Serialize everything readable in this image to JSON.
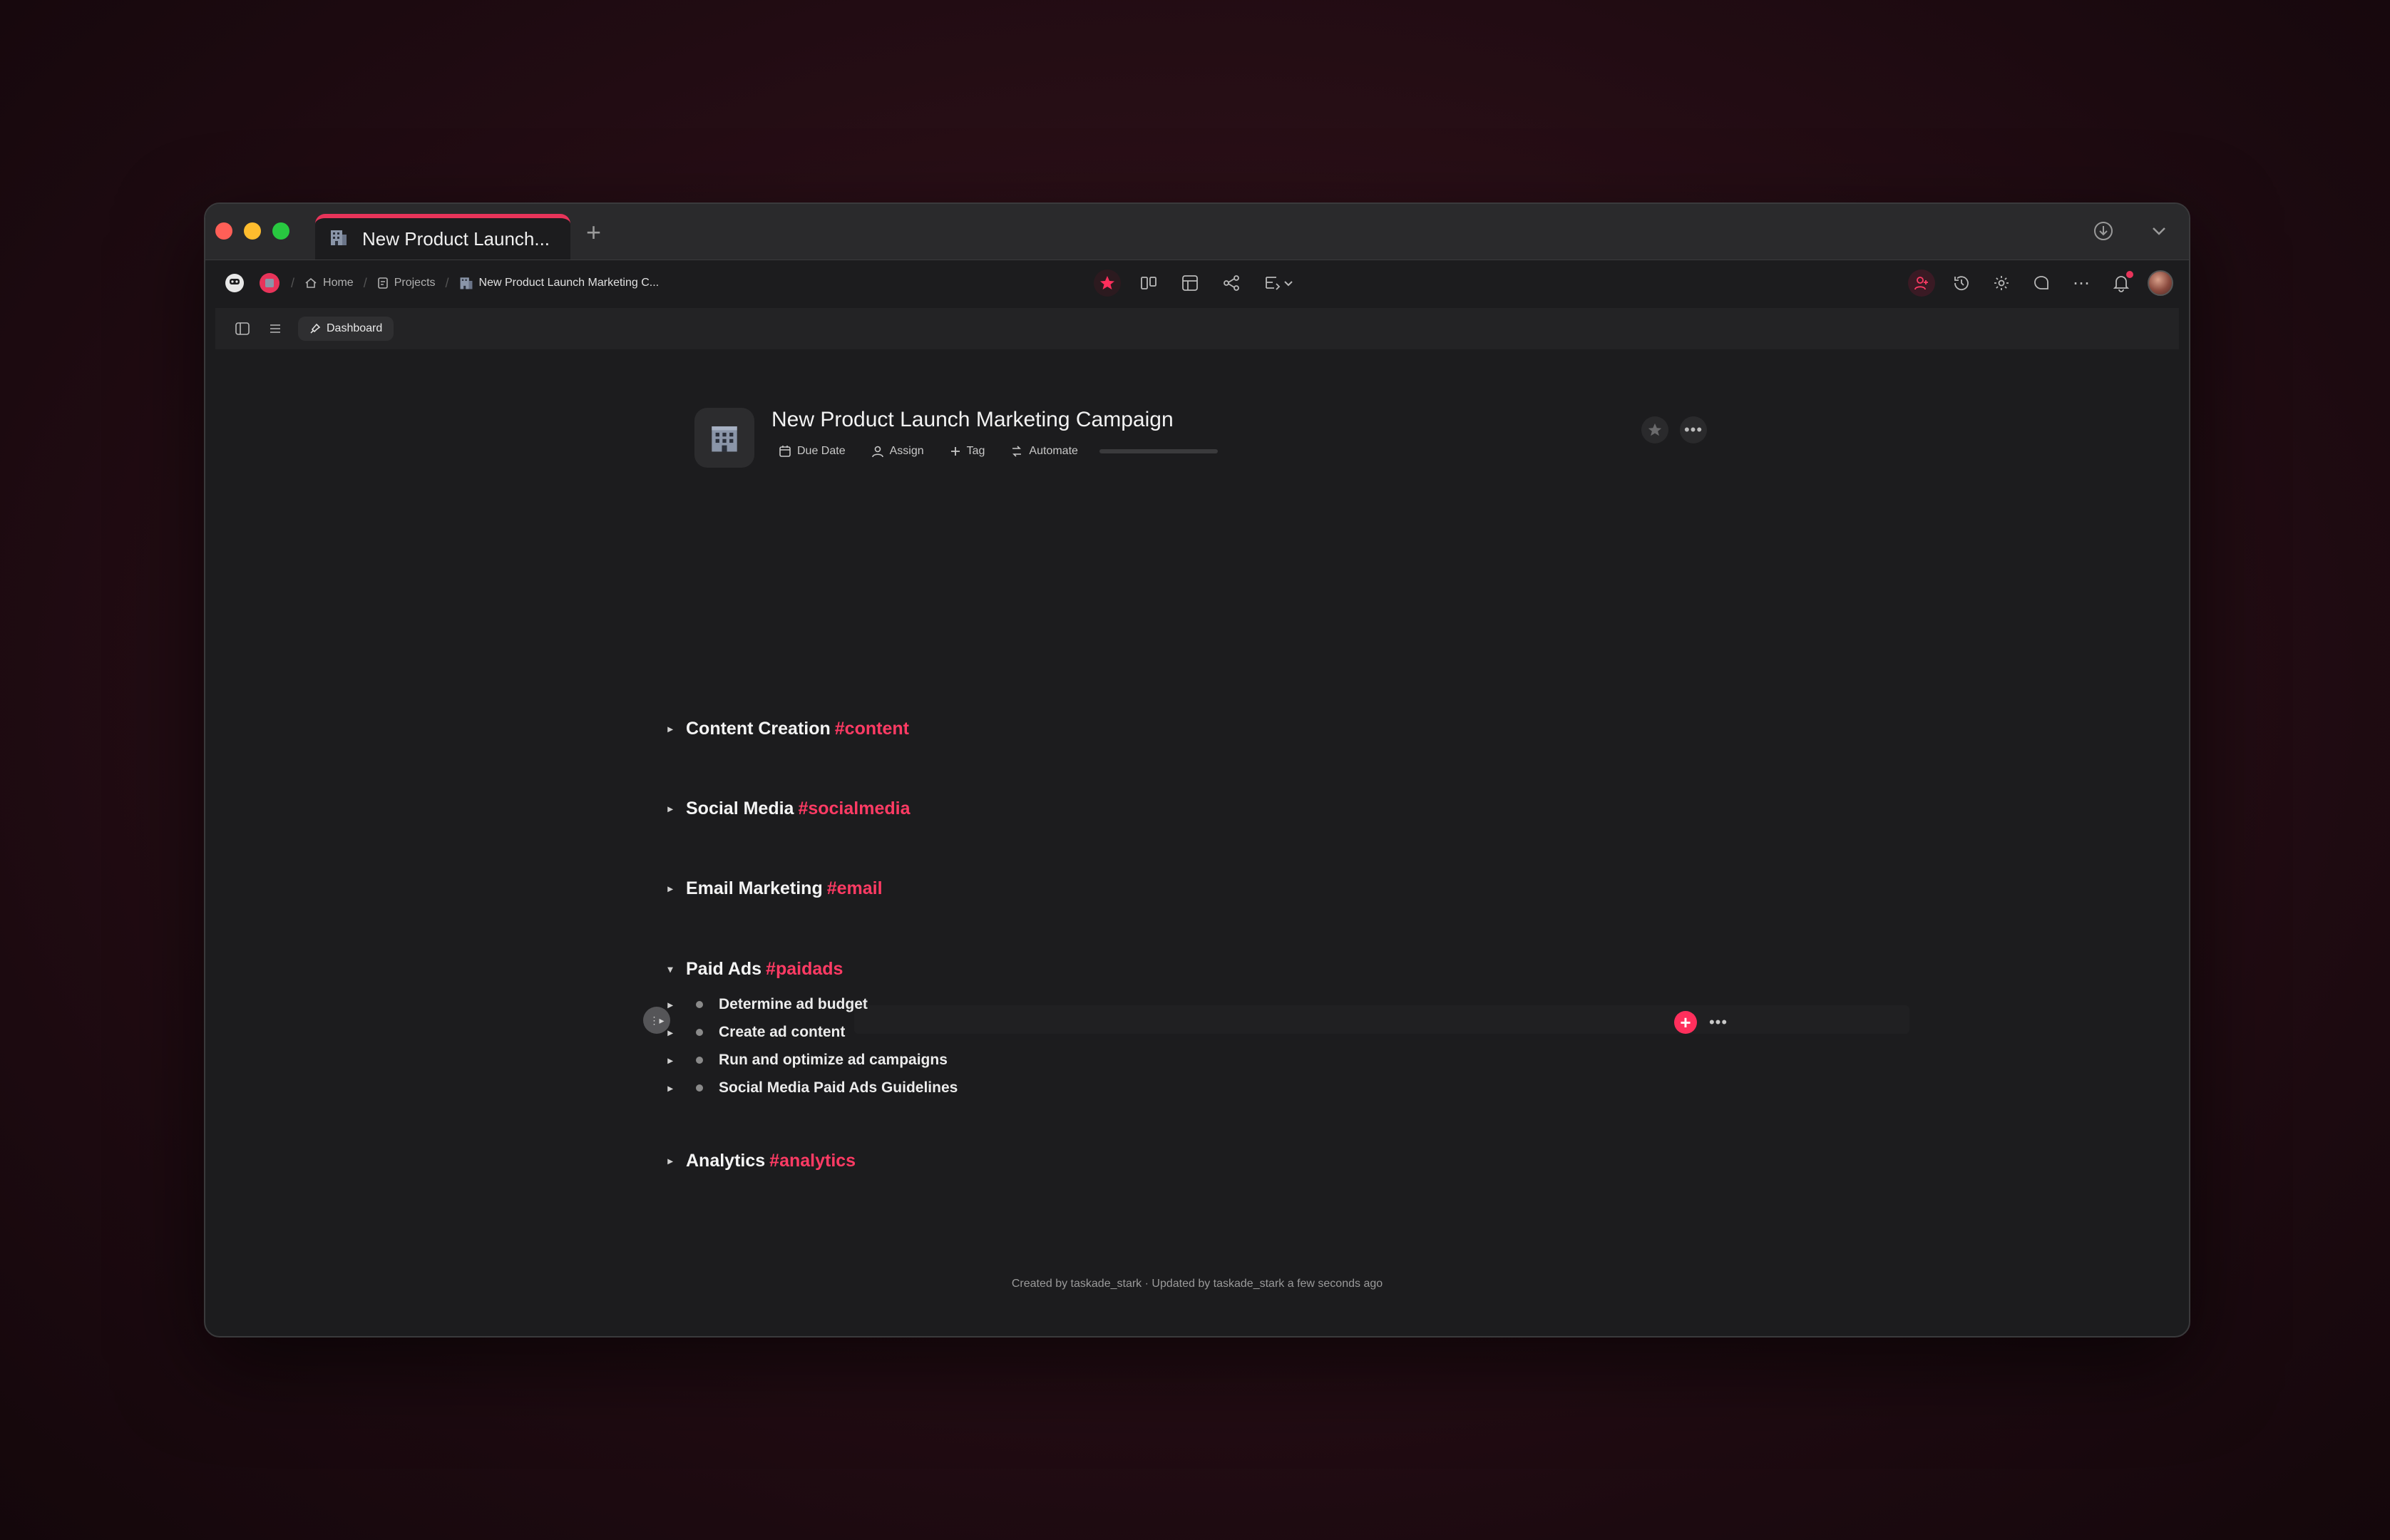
{
  "window": {
    "tab_title": "New Product Launch...",
    "new_tab_symbol": "+"
  },
  "toolbar": {
    "breadcrumbs": [
      {
        "label": "Home"
      },
      {
        "label": "Projects"
      },
      {
        "label": "New Product Launch Marketing C..."
      }
    ]
  },
  "subbar": {
    "view_label": "Dashboard"
  },
  "project": {
    "title": "New Product Launch Marketing Campaign",
    "meta": {
      "due_date": "Due Date",
      "assign": "Assign",
      "tag": "Tag",
      "automate": "Automate"
    },
    "progress": 0
  },
  "sections": [
    {
      "label": "Content Creation",
      "tag": "#content"
    },
    {
      "label": "Social Media",
      "tag": "#socialmedia"
    },
    {
      "label": "Email Marketing",
      "tag": "#email"
    },
    {
      "label": "Paid Ads",
      "tag": "#paidads",
      "children": [
        {
          "label": "Determine ad budget"
        },
        {
          "label": "Create ad content"
        },
        {
          "label": "Run and optimize ad campaigns"
        },
        {
          "label": "Social Media Paid Ads Guidelines"
        }
      ]
    },
    {
      "label": "Analytics",
      "tag": "#analytics"
    }
  ],
  "footer": {
    "text": "Created by taskade_stark · Updated by taskade_stark a few seconds ago"
  },
  "colors": {
    "accent": "#ff3b64",
    "tab_accent": "#e8345a",
    "background": "#1c1c1e"
  },
  "icons": {
    "tab": "building-icon",
    "home": "home-icon",
    "projects": "document-icon",
    "favorite": "star-icon"
  }
}
